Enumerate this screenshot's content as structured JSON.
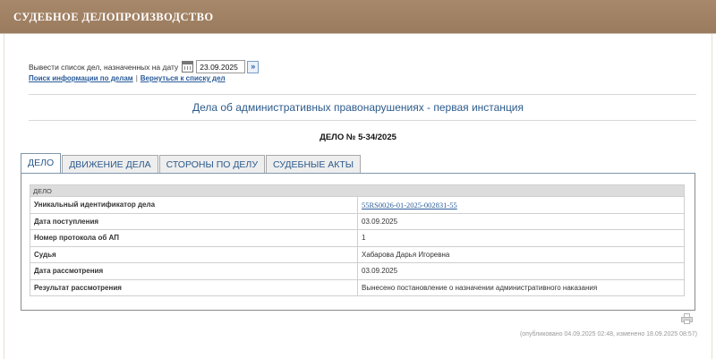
{
  "header": {
    "title": "СУДЕБНОЕ ДЕЛОПРОИЗВОДСТВО"
  },
  "date_filter": {
    "label": "Вывести список дел, назначенных на дату",
    "date_value": "23.09.2025",
    "go_symbol": "»",
    "calendar_icon": "calendar-icon"
  },
  "links": {
    "search": "Поиск информации по делам",
    "separator": "|",
    "back": "Вернуться к списку дел"
  },
  "case_category": "Дела об административных правонарушениях - первая инстанция",
  "case_number": "ДЕЛО № 5-34/2025",
  "tabs": [
    {
      "label": "ДЕЛО",
      "active": true
    },
    {
      "label": "ДВИЖЕНИЕ ДЕЛА",
      "active": false
    },
    {
      "label": "СТОРОНЫ ПО ДЕЛУ",
      "active": false
    },
    {
      "label": "СУДЕБНЫЕ АКТЫ",
      "active": false
    }
  ],
  "case_table": {
    "section_title": "ДЕЛО",
    "rows": [
      {
        "label": "Уникальный идентификатор дела",
        "value": "55RS0026-01-2025-002831-55",
        "link": true
      },
      {
        "label": "Дата поступления",
        "value": "03.09.2025"
      },
      {
        "label": "Номер протокола об АП",
        "value": "1"
      },
      {
        "label": "Судья",
        "value": "Хабарова Дарья Игоревна"
      },
      {
        "label": "Дата рассмотрения",
        "value": "03.09.2025"
      },
      {
        "label": "Результат рассмотрения",
        "value": "Вынесено постановление о назначении административного наказания"
      }
    ]
  },
  "footer": {
    "meta": "(опубликовано 04.09.2025 02:48, изменено 18.09.2025 08:57)",
    "print_icon": "printer-icon"
  },
  "colors": {
    "header_bg": "#9a7b5e",
    "link": "#2a5c9a",
    "category_text": "#2c5b8c"
  }
}
